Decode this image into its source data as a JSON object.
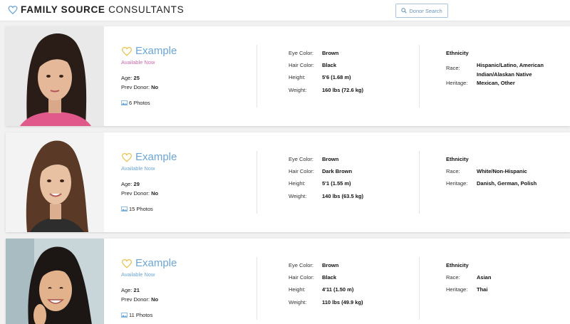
{
  "header": {
    "logo_bold": "FAMILY SOURCE",
    "logo_light": " CONSULTANTS",
    "search_label": "Donor Search"
  },
  "colors": {
    "accent_blue": "#6aa6d8",
    "heart_gold": "#e8c24a",
    "available_pink": "#d06aa8",
    "available_blue": "#6aa6d8"
  },
  "labels": {
    "eye": "Eye Color:",
    "hair": "Hair Color:",
    "height": "Height:",
    "weight": "Weight:",
    "ethnicity": "Ethnicity",
    "race": "Race:",
    "heritage": "Heritage:",
    "age": "Age:",
    "prev": "Prev Donor:"
  },
  "donors": [
    {
      "name": "Example",
      "availability": "Available Now",
      "availability_color": "pink",
      "age": "25",
      "prev_donor": "No",
      "photos": "6 Photos",
      "eye_color": "Brown",
      "hair_color": "Black",
      "height": "5'6 (1.68 m)",
      "weight": "160 lbs (72.6 kg)",
      "race": "Hispanic/Latino, American Indian/Alaskan Native",
      "heritage": "Mexican, Other"
    },
    {
      "name": "Example",
      "availability": "Available Now",
      "availability_color": "blue",
      "age": "29",
      "prev_donor": "No",
      "photos": "15 Photos",
      "eye_color": "Brown",
      "hair_color": "Dark Brown",
      "height": "5'1 (1.55 m)",
      "weight": "140 lbs (63.5 kg)",
      "race": "White/Non-Hispanic",
      "heritage": "Danish, German, Polish"
    },
    {
      "name": "Example",
      "availability": "Available Now",
      "availability_color": "blue",
      "age": "21",
      "prev_donor": "No",
      "photos": "11 Photos",
      "eye_color": "Brown",
      "hair_color": "Black",
      "height": "4'11 (1.50 m)",
      "weight": "110 lbs (49.9 kg)",
      "race": "Asian",
      "heritage": "Thai"
    }
  ]
}
